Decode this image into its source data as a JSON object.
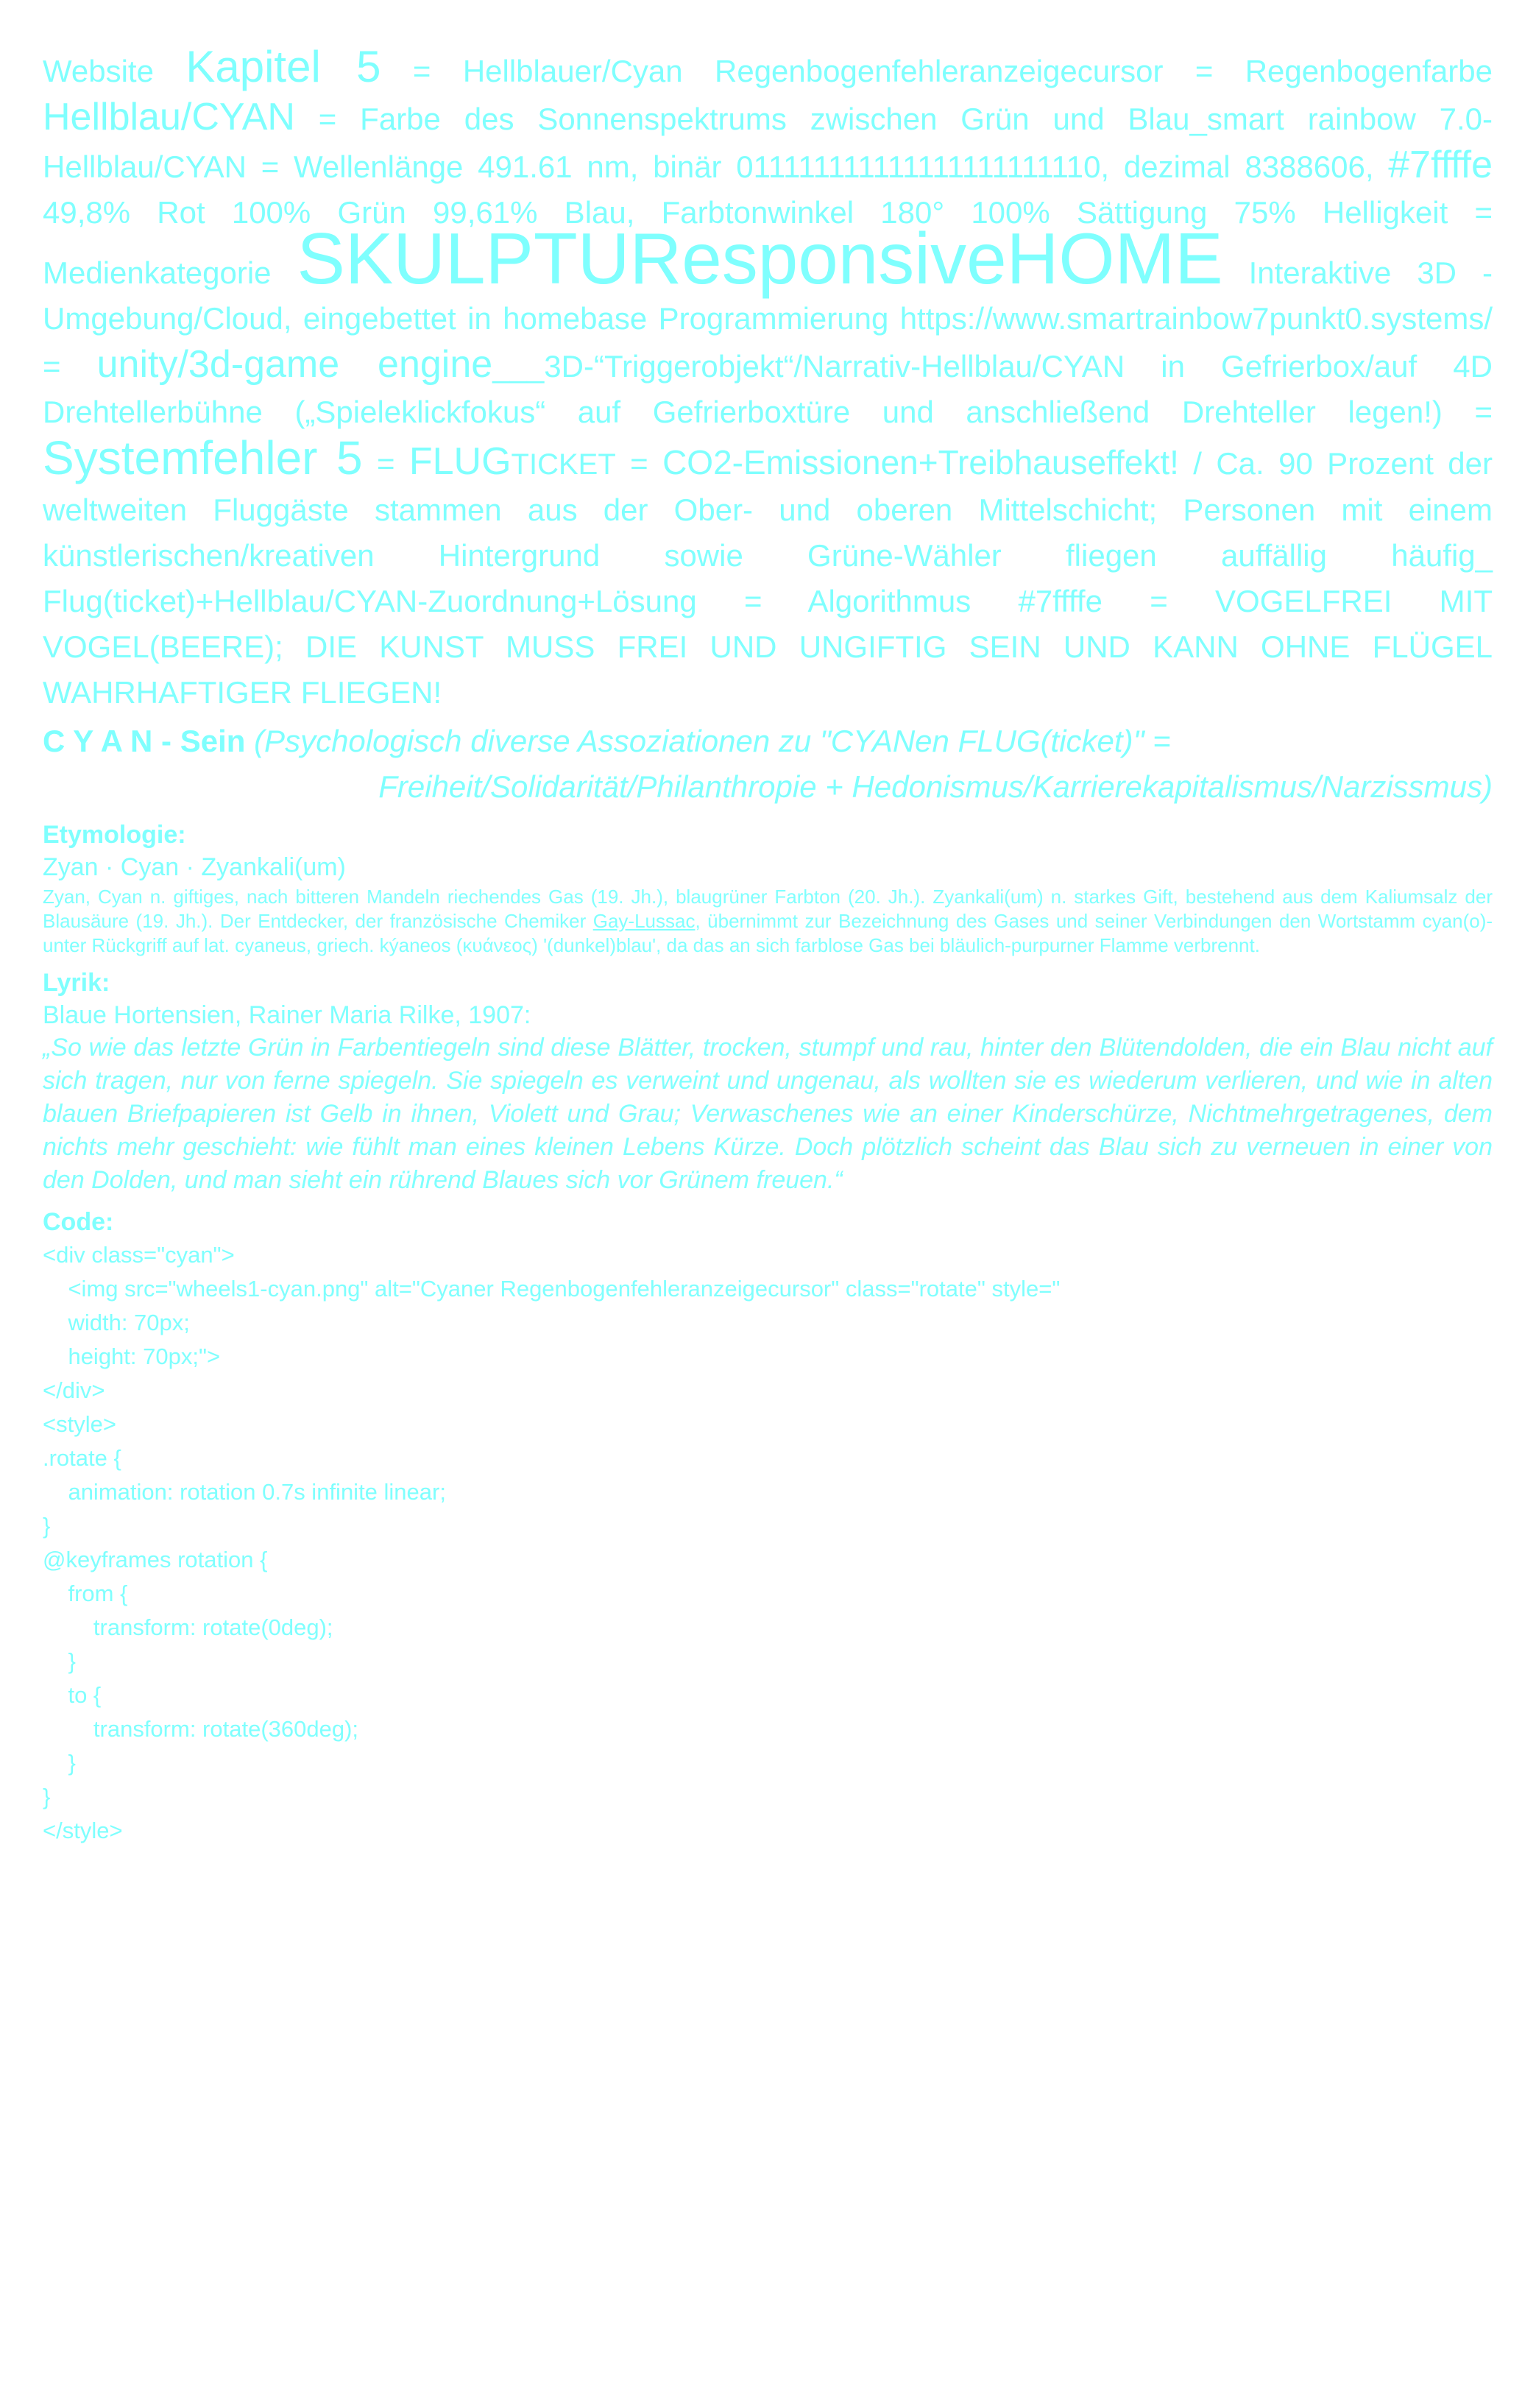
{
  "colors": {
    "text": "#7ffffe",
    "background": "#ffffff"
  },
  "intro": {
    "t01": "Website ",
    "t02": "Kapitel 5",
    "t03": " = Hellblauer/Cyan Regenbogenfehleranzeigecursor = Regenbogenfarbe ",
    "t04": "Hellblau/CYAN",
    "t05": " = Farbe des Sonnenspektrums zwischen Grün und Blau_smart rainbow 7.0-Hellblau/CYAN = Wellenlänge 491.61 nm, binär 011111111111111111111110, dezimal 8388606, ",
    "t06": "#7ffffe",
    "t07": " 49,8% Rot 100% Grün 99,61% Blau, Farbtonwinkel 180° 100% Sättigung 75% Helligkeit = Medienkategorie ",
    "t08": "SKULPTUResponsiveHOME",
    "t09": " Interaktive 3D - Umgebung/Cloud, eingebettet in homebase Programmierung https://www.smartrainbow7punkt0.systems/ = ",
    "t10": "unity/3d-game engine",
    "t11": "___3D-“Triggerobjekt“/Narrativ-Hellblau/CYAN in Gefrierbox/auf 4D Drehtellerbühne („Spieleklickfokus“ auf Gefrierboxtüre und anschließend Drehteller legen!) = ",
    "t12": "Systemfehler 5",
    "t13": " = ",
    "t14": "FLUG",
    "t15": "TICKET",
    "t16": " = ",
    "t17": "CO2-Emissionen+Treibhauseffekt!",
    "t18": " / Ca. 90 Prozent der weltweiten Fluggäste stammen aus der Ober- und oberen Mittelschicht; Personen mit einem künstlerischen/kreativen Hintergrund sowie Grüne-Wähler fliegen auffällig häufig_ Flug(ticket)+Hellblau/CYAN-Zuordnung+Lösung = Algorithmus #7ffffe = VOGELFREI MIT VOGEL(BEERE); DIE KUNST MUSS FREI UND UNGIFTIG SEIN UND KANN OHNE FLÜGEL WAHRHAFTIGER FLIEGEN!"
  },
  "cyan_sein": {
    "bold": "C Y A N - Sein",
    "italic1": " (Psychologisch diverse Assoziationen zu \"CYANen FLUG(ticket)\" =",
    "italic2": "Freiheit/Solidarität/Philanthropie + Hedonismus/Karrierekapitalismus/Narzissmus)"
  },
  "etymology": {
    "heading": "Etymologie:",
    "line": "Zyan · Cyan · Zyankali(um)",
    "p1": "Zyan, Cyan n. giftiges, nach bitteren Mandeln riechendes Gas (19. Jh.), blaugrüner Farbton (20. Jh.). Zyankali(um) n. starkes Gift, bestehend aus dem Kaliumsalz der Blausäure (19. Jh.). Der Entdecker, der französische Chemiker ",
    "link": "Gay-Lussac",
    "p2": ", übernimmt zur Bezeichnung des Gases und seiner Verbindungen den Wortstamm cyan(o)- unter Rückgriff auf lat. cyaneus, griech. kýaneos (κυάνεος) '(dunkel)blau', da das an sich farblose Gas bei bläulich-purpurner Flamme verbrennt."
  },
  "lyric": {
    "heading": "Lyrik:",
    "source": "Blaue Hortensien, Rainer Maria Rilke, 1907:",
    "poem": "„So wie das letzte Grün in Farbentiegeln sind diese Blätter, trocken, stumpf und rau, hinter den Blütendolden, die ein Blau nicht auf sich tragen, nur von ferne spiegeln. Sie spiegeln es verweint und ungenau, als wollten sie es wiederum verlieren, und wie in alten blauen Briefpapieren ist Gelb in ihnen, Violett und Grau; Verwaschenes wie an einer Kinderschürze, Nichtmehrgetragenes, dem nichts mehr geschieht: wie fühlt man eines kleinen Lebens Kürze. Doch plötzlich scheint das Blau sich zu verneuen in einer von den Dolden, und man sieht ein rührend Blaues sich vor Grünem freuen.“"
  },
  "code": {
    "heading": "Code:",
    "lines": [
      "<div class=\"cyan\">",
      "    <img src=\"wheels1-cyan.png\" alt=\"Cyaner Regenbogenfehleranzeigecursor\" class=\"rotate\" style=\"",
      "    width: 70px;",
      "    height: 70px;\">",
      "</div>",
      "<style>",
      ".rotate {",
      "    animation: rotation 0.7s infinite linear;",
      "}",
      "@keyframes rotation {",
      "    from {",
      "        transform: rotate(0deg);",
      "    }",
      "    to {",
      "        transform: rotate(360deg);",
      "    }",
      "}",
      "</style>"
    ]
  }
}
